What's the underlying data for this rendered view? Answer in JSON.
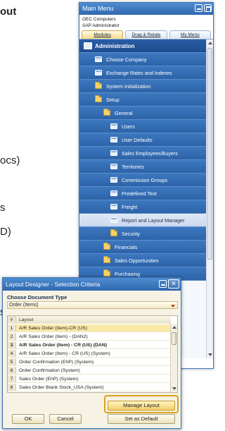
{
  "background_text": [
    {
      "text": "out",
      "bold": true
    },
    {
      "text": "ocs)",
      "bold": false
    },
    {
      "text": "s",
      "bold": false
    },
    {
      "text": "D)",
      "bold": false
    },
    {
      "text": "s",
      "bold": false
    }
  ],
  "main_menu": {
    "title": "Main Menu",
    "company": "OEC Computers",
    "user": "SAP Administrator",
    "tabs": [
      "Modules",
      "Drag & Relate",
      "My Menu"
    ],
    "items": [
      {
        "label": "Administration",
        "icon": "module-icon",
        "level": 0,
        "type": "header"
      },
      {
        "label": "Choose Company",
        "icon": "window-icon",
        "level": 1
      },
      {
        "label": "Exchange Rates and Indexes",
        "icon": "window-icon",
        "level": 1
      },
      {
        "label": "System Initialization",
        "icon": "folder-icon",
        "level": 1
      },
      {
        "label": "Setup",
        "icon": "folder-open-icon",
        "level": 1
      },
      {
        "label": "General",
        "icon": "folder-open-icon",
        "level": 2
      },
      {
        "label": "Users",
        "icon": "window-icon",
        "level": 3
      },
      {
        "label": "User Defaults",
        "icon": "window-icon",
        "level": 3
      },
      {
        "label": "Sales Employees/Buyers",
        "icon": "window-icon",
        "level": 3
      },
      {
        "label": "Territories",
        "icon": "window-icon",
        "level": 3
      },
      {
        "label": "Commission Groups",
        "icon": "window-icon",
        "level": 3
      },
      {
        "label": "Predefined Text",
        "icon": "window-icon",
        "level": 3
      },
      {
        "label": "Freight",
        "icon": "window-icon",
        "level": 3
      },
      {
        "label": "Report and Layout Manager",
        "icon": "window-icon",
        "level": 3,
        "selected": true
      },
      {
        "label": "Security",
        "icon": "folder-icon",
        "level": 3
      },
      {
        "label": "Financials",
        "icon": "folder-icon",
        "level": 2
      },
      {
        "label": "Sales Opportunities",
        "icon": "folder-icon",
        "level": 2
      },
      {
        "label": "Purchasing",
        "icon": "folder-icon",
        "level": 2
      }
    ]
  },
  "dialog": {
    "title": "Layout Designer - Selection Criteria",
    "choose_label": "Choose Document Type",
    "document_type": "Order (Items)",
    "grid_header": {
      "num": "#",
      "col": "Layout"
    },
    "rows": [
      {
        "num": "1",
        "text": "A/R Sales Order (Item)-CR (US)",
        "highlight": true
      },
      {
        "num": "2",
        "text": "A/R Sales Order (Item) - (DAN2)"
      },
      {
        "num": "3",
        "text": "A/R Sales Order (Item) - CR (US) (DAN)",
        "bold": true
      },
      {
        "num": "4",
        "text": "A/R Sales Order (Item) - CR (US) (System)"
      },
      {
        "num": "5",
        "text": "Order Confirmation (EhP) (System)"
      },
      {
        "num": "6",
        "text": "Order Confirmation (System)"
      },
      {
        "num": "7",
        "text": "Sales Order (EhP) (System)"
      },
      {
        "num": "8",
        "text": "Sales Order Blank Stock_USA (System)"
      }
    ],
    "buttons": {
      "ok": "OK",
      "cancel": "Cancel",
      "manage": "Manage Layout",
      "default": "Set as Default"
    }
  }
}
